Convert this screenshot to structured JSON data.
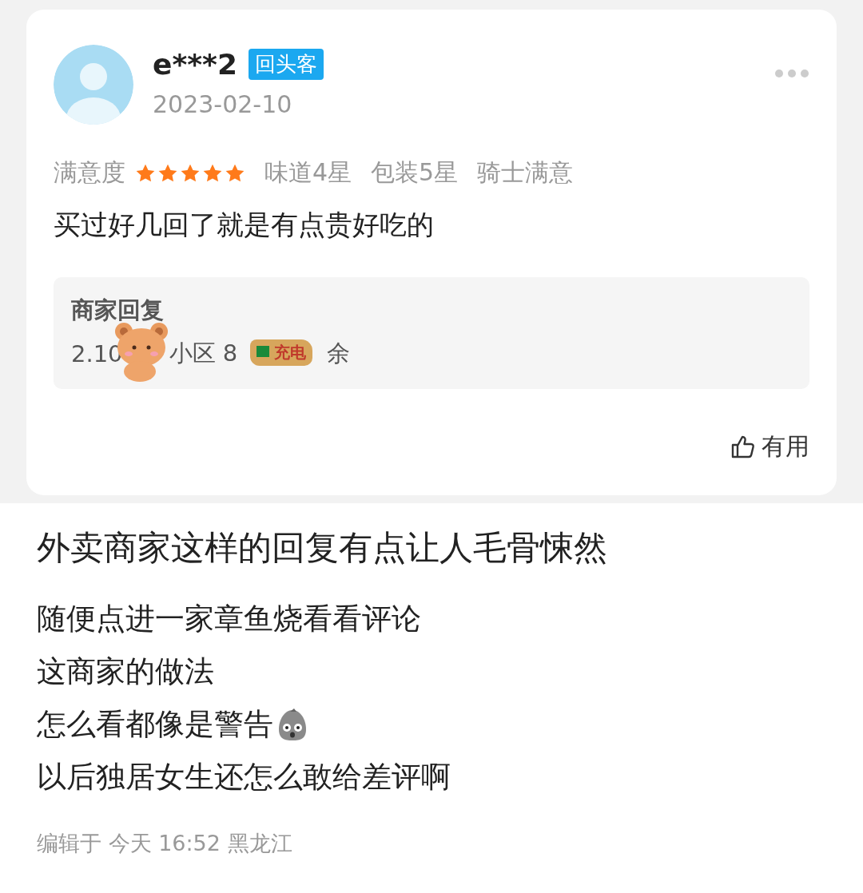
{
  "review": {
    "username": "e***2",
    "badge": "回头客",
    "date": "2023-02-10",
    "rating": {
      "label": "满意度",
      "stars": 5
    },
    "sub_ratings": [
      "味道4星",
      "包装5星",
      "骑士满意"
    ],
    "text": "买过好几回了就是有点贵好吃的",
    "merchant_reply": {
      "title": "商家回复",
      "visible_parts": [
        "2.10",
        "小区 8",
        "余"
      ],
      "sticker_text": "充电"
    },
    "helpful": "有用"
  },
  "post": {
    "title": "外卖商家这样的回复有点让人毛骨悚然",
    "lines": [
      {
        "text": "随便点进一家章鱼烧看看评论",
        "emoji": false
      },
      {
        "text": "这商家的做法",
        "emoji": false
      },
      {
        "text": "怎么看都像是警告",
        "emoji": true
      },
      {
        "text": "以后独居女生还怎么敢给差评啊",
        "emoji": false
      }
    ],
    "footer": "编辑于 今天 16:52 黑龙江"
  }
}
